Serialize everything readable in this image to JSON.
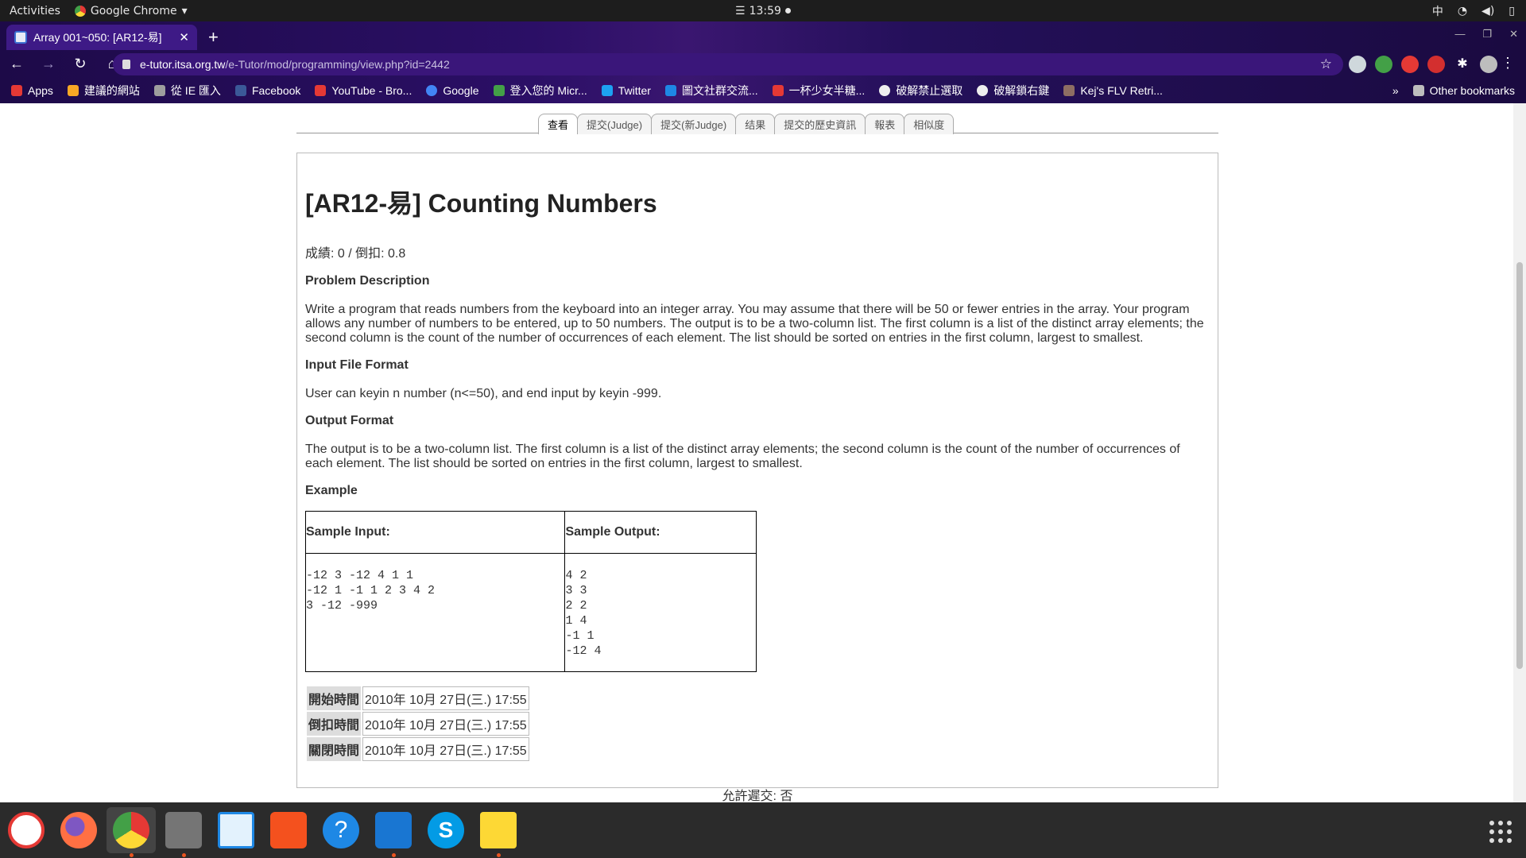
{
  "topbar": {
    "activities": "Activities",
    "app_name": "Google Chrome",
    "clock": "13:59",
    "input_method": "中"
  },
  "browser": {
    "tab_title": "Array 001~050: [AR12-易]",
    "url_host": "e-tutor.itsa.org.tw",
    "url_path": "/e-Tutor/mod/programming/view.php?id=2442",
    "bookmarks": [
      {
        "label": "Apps",
        "color": "#e53935"
      },
      {
        "label": "建議的網站",
        "color": "#f9a825"
      },
      {
        "label": "從 IE 匯入",
        "color": "#9e9e9e"
      },
      {
        "label": "Facebook",
        "color": "#3b5998"
      },
      {
        "label": "YouTube - Bro...",
        "color": "#e53935"
      },
      {
        "label": "Google",
        "color": "#4285f4"
      },
      {
        "label": "登入您的 Micr...",
        "color": "#43a047"
      },
      {
        "label": "Twitter",
        "color": "#1da1f2"
      },
      {
        "label": "圖文社群交流...",
        "color": "#1e88e5"
      },
      {
        "label": "一杯少女半糖...",
        "color": "#e53935"
      },
      {
        "label": "破解禁止選取",
        "color": "#eeeeee"
      },
      {
        "label": "破解鎖右鍵",
        "color": "#eeeeee"
      },
      {
        "label": "Kej's FLV Retri...",
        "color": "#8d6e63"
      }
    ],
    "other_bookmarks": "Other bookmarks"
  },
  "page": {
    "tabs": [
      "查看",
      "提交(Judge)",
      "提交(新Judge)",
      "结果",
      "提交的歷史資訊",
      "報表",
      "相似度"
    ],
    "title": "[AR12-易] Counting Numbers",
    "grade": "成績: 0 / 倒扣: 0.8",
    "problem_heading": "Problem Description",
    "problem_text": "Write a program that reads numbers from the keyboard into an integer array. You may assume that there will be 50 or fewer entries in the array. Your program allows any number of numbers to be entered, up to 50 numbers. The output is to be a two-column list. The first column is a list of the distinct array elements; the second column is the count of the number of occurrences of each element. The list should be sorted on entries in the first column, largest to smallest.",
    "input_heading": "Input File Format",
    "input_text": "User can keyin n number (n<=50), and end input by keyin -999.",
    "output_heading": "Output Format",
    "output_text": "The output is to be a two-column list. The first column is a list of the distinct array elements; the second column is the count of the number of occurrences of each element. The list should be sorted on entries in the first column, largest to smallest.",
    "example_heading": "Example",
    "sample_input_label": "Sample Input:",
    "sample_output_label": "Sample Output:",
    "sample_input": "-12 3 -12 4 1 1\n-12 1 -1 1 2 3 4 2\n3 -12 -999",
    "sample_output": "4 2\n3 3\n2 2\n1 4\n-1 1\n-12 4",
    "times": [
      {
        "label": "開始時間",
        "value": "2010年 10月 27日(三.) 17:55"
      },
      {
        "label": "倒扣時間",
        "value": "2010年 10月 27日(三.) 17:55"
      },
      {
        "label": "關閉時間",
        "value": "2010年 10月 27日(三.) 17:55"
      }
    ],
    "late_submission": "允許遲交: 否"
  },
  "dock": {
    "apps": [
      {
        "name": "yandex-browser-icon",
        "color": "#e53935"
      },
      {
        "name": "firefox-icon",
        "color": "#ff7043"
      },
      {
        "name": "chrome-icon",
        "color": "#4caf50"
      },
      {
        "name": "files-icon",
        "color": "#9e9e9e"
      },
      {
        "name": "image-viewer-icon",
        "color": "#1e88e5"
      },
      {
        "name": "software-center-icon",
        "color": "#f4511e"
      },
      {
        "name": "help-icon",
        "color": "#1e88e5"
      },
      {
        "name": "vscode-icon",
        "color": "#1976d2"
      },
      {
        "name": "skype-icon",
        "color": "#039be5"
      },
      {
        "name": "text-editor-icon",
        "color": "#fdd835"
      }
    ]
  }
}
